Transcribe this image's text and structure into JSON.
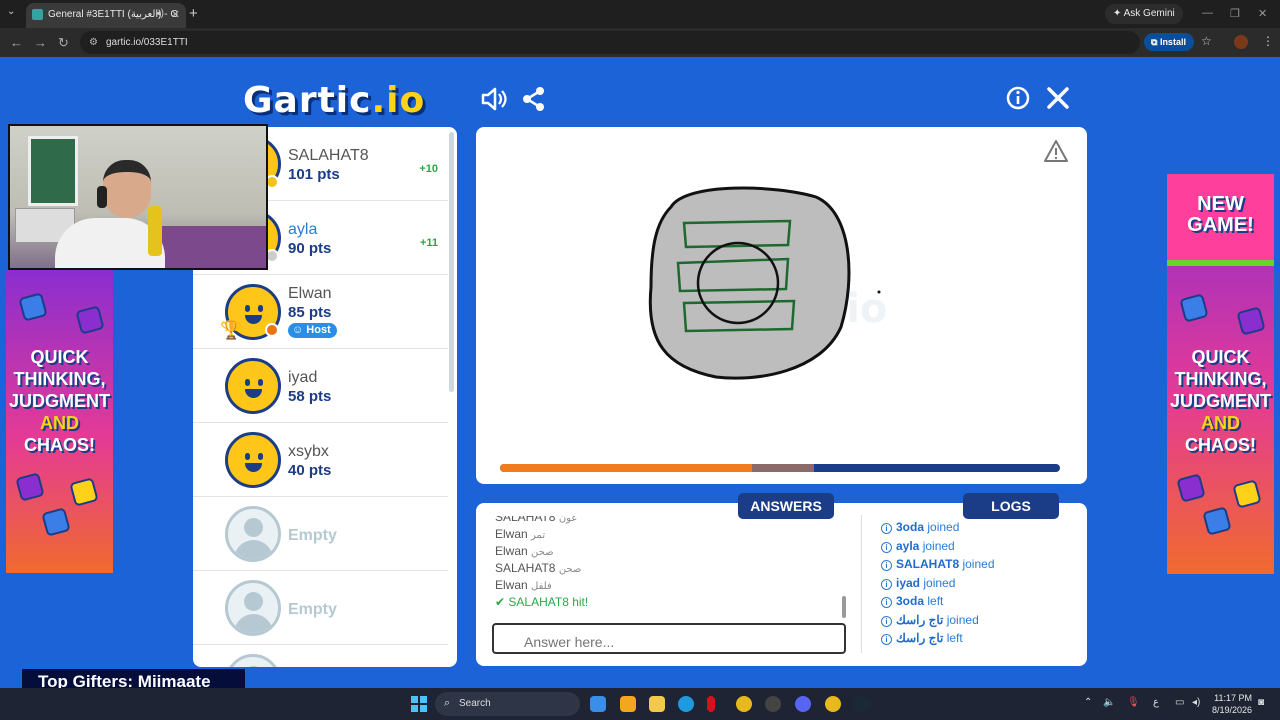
{
  "browser": {
    "tab_title": "General #3E1TTI (العربية) - G",
    "address": "gartic.io/033E1TTI",
    "ask_gemini": "Ask Gemini",
    "install_label": "Install"
  },
  "game": {
    "logo_main": "Gartic",
    "logo_io": ".io",
    "players": [
      {
        "name": "SALAHAT8",
        "points": "101 pts",
        "gain": "+10",
        "status_color": "#f4c21a"
      },
      {
        "name": "ayla",
        "points": "90 pts",
        "gain": "+11",
        "status_color": "#cccccc"
      },
      {
        "name": "Elwan",
        "points": "85 pts",
        "host_label": "Host",
        "status_color": "#e8751a"
      },
      {
        "name": "iyad",
        "points": "58 pts"
      },
      {
        "name": "xsybx",
        "points": "40 pts"
      },
      {
        "name": "Empty"
      },
      {
        "name": "Empty"
      }
    ],
    "tabs": {
      "answers": "ANSWERS",
      "logs": "LOGS"
    },
    "answers": [
      {
        "user": "SALAHAT8",
        "word": "عون"
      },
      {
        "user": "Elwan",
        "word": "تمر"
      },
      {
        "user": "Elwan",
        "word": "صحن"
      },
      {
        "user": "SALAHAT8",
        "word": "صحن"
      },
      {
        "user": "Elwan",
        "word": "فلفل"
      }
    ],
    "hit": {
      "user": "SALAHAT8",
      "text": "hit!"
    },
    "answer_placeholder": "Answer here...",
    "logs": [
      {
        "user": "3oda",
        "action": "joined"
      },
      {
        "user": "ayla",
        "action": "joined"
      },
      {
        "user": "SALAHAT8",
        "action": "joined"
      },
      {
        "user": "iyad",
        "action": "joined"
      },
      {
        "user": "3oda",
        "action": "left"
      },
      {
        "user": "تاج راسك",
        "action": "joined"
      },
      {
        "user": "تاج راسك",
        "action": "left"
      }
    ],
    "timer_progress": 0.45
  },
  "ads": {
    "new_game": "NEW GAME!",
    "line1": "QUICK",
    "line2": "THINKING,",
    "line3": "JUDGMENT",
    "line4": "AND",
    "line5": "CHAOS!"
  },
  "overlay": {
    "gifters": "Top Gifters: Miimaate"
  },
  "taskbar": {
    "search_label": "Search",
    "lang": "ع",
    "time": "11:17 PM",
    "date": "8/19/2026"
  }
}
